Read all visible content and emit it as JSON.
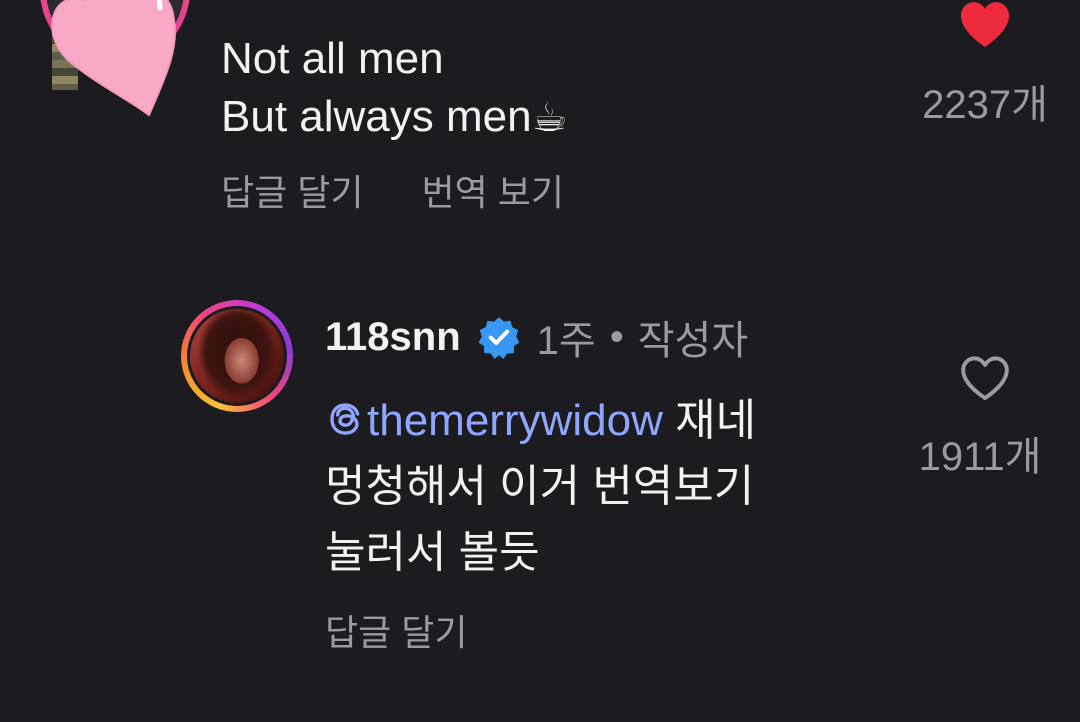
{
  "comments": [
    {
      "body_lines": [
        "Not all men",
        "But always men"
      ],
      "emoji": "☕",
      "actions": [
        "답글 달기",
        "번역 보기"
      ],
      "like_count": "2237개",
      "liked": true
    },
    {
      "username": "118snn",
      "verified": true,
      "time": "1주",
      "separator": "•",
      "author_tag": "작성자",
      "mention": "themerrywidow",
      "body_line1_rest": " 재네",
      "body_line2": "멍청해서 이거 번역보기",
      "body_line3": "눌러서 볼듯",
      "actions": [
        "답글 달기"
      ],
      "like_count": "1911개",
      "liked": false
    }
  ],
  "colors": {
    "background": "#1c1c20",
    "primary_text": "#f2f2f2",
    "secondary_text": "#9a9aa0",
    "mention": "#8fa6ff",
    "like_red": "#ee2a3f",
    "verified_blue": "#3897f0"
  },
  "icons": {
    "liked": "heart-filled-icon",
    "unliked": "heart-outline-icon",
    "verified": "verified-badge-icon",
    "mention": "threads-icon"
  }
}
